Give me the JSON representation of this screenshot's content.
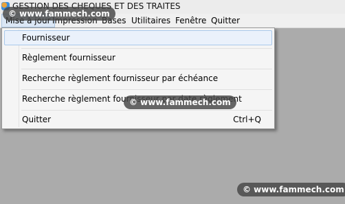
{
  "window": {
    "title": "GESTION DES CHEQUES ET DES TRAITES"
  },
  "menubar": {
    "items": [
      {
        "label": "Mise à jour"
      },
      {
        "label": "Impression"
      },
      {
        "label": "Bases"
      },
      {
        "label": "Utilitaires"
      },
      {
        "label": "Fenêtre"
      },
      {
        "label": "Quitter"
      }
    ]
  },
  "dropdown": {
    "items": [
      {
        "label": "Fournisseur",
        "shortcut": ""
      },
      {
        "label": "Règlement fournisseur",
        "shortcut": ""
      },
      {
        "label": "Recherche règlement fournisseur par échéance",
        "shortcut": ""
      },
      {
        "label": "Recherche règlement fournisseur par date règlement",
        "shortcut": ""
      },
      {
        "label": "Quitter",
        "shortcut": "Ctrl+Q"
      }
    ]
  },
  "watermark": {
    "text": "© www.fammech.com"
  }
}
